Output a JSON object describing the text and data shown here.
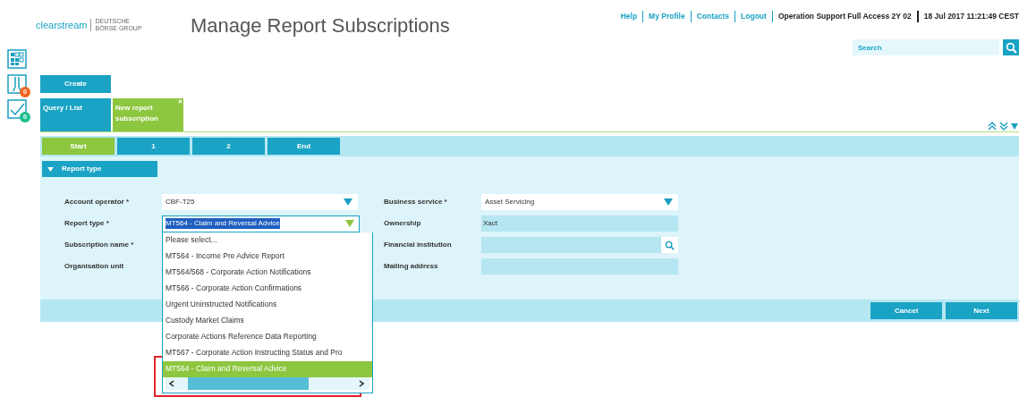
{
  "header": {
    "logo": "clearstream",
    "logo_group": "DEUTSCHE BÖRSE GROUP",
    "title": "Manage Report Subscriptions",
    "links": [
      "Help",
      "My Profile",
      "Contacts",
      "Logout"
    ],
    "user": "Operation Support Full Access 2Y 02",
    "datetime": "18 Jul 2017 11:21:49 CEST"
  },
  "search": {
    "placeholder": "Search"
  },
  "sidebar": [
    {
      "kind": "grid"
    },
    {
      "kind": "clipboard",
      "badge": "0",
      "color": "#f26522"
    },
    {
      "kind": "checklist",
      "badge": "0",
      "color": "#1fbf8f"
    }
  ],
  "create_button": "Create",
  "tabs": [
    {
      "label": "Query / List",
      "selected": false
    },
    {
      "label": "New report subscription",
      "selected": true
    }
  ],
  "steps": [
    {
      "label": "Start",
      "selected": true
    },
    {
      "label": "1",
      "selected": false
    },
    {
      "label": "2",
      "selected": false
    },
    {
      "label": "End",
      "selected": false
    }
  ],
  "section": {
    "title": "Report type",
    "expanded": true
  },
  "left_fields": [
    {
      "label": "Account operator *",
      "kind": "select",
      "value": "CBF-T25"
    },
    {
      "label": "Report type *",
      "kind": "open_select",
      "value": "MT564 - Claim and Reversal Advice",
      "options": [
        {
          "label": "Please select...",
          "selected": false
        },
        {
          "label": "MT564 - Income Pre Advice Report",
          "selected": false
        },
        {
          "label": "MT564/568 - Corporate Action Notifications",
          "selected": false
        },
        {
          "label": "MT566 - Corporate Action Confirmations",
          "selected": false
        },
        {
          "label": "Urgent Uninstructed Notifications",
          "selected": false
        },
        {
          "label": "Custody Market Claims",
          "selected": false
        },
        {
          "label": "Corporate Actions Reference Data Reporting",
          "selected": false
        },
        {
          "label": "MT567 - Corporate Action Instructing Status and Pro",
          "selected": false
        },
        {
          "label": "MT564 - Claim and Reversal Advice",
          "selected": true
        }
      ]
    },
    {
      "label": "Subscription name *"
    },
    {
      "label": "Organisation unit"
    }
  ],
  "right_fields": [
    {
      "label": "Business service *",
      "kind": "select",
      "value": "Asset Servicing"
    },
    {
      "label": "Ownership",
      "kind": "readonly",
      "value": "Xact"
    },
    {
      "label": "Financial institution",
      "kind": "lookup"
    },
    {
      "label": "Mailing address",
      "kind": "text"
    }
  ],
  "buttons": [
    "Cancel",
    "Next"
  ]
}
